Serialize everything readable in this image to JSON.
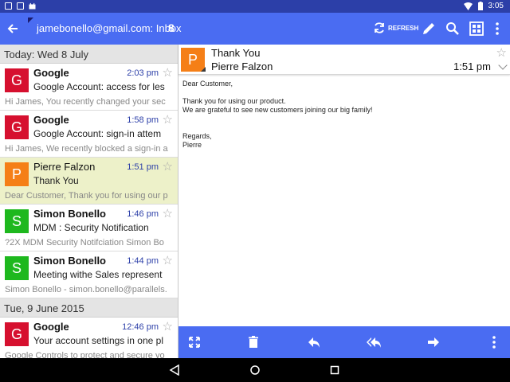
{
  "status_bar": {
    "time": "3:05"
  },
  "app_bar": {
    "account_title": "jamebonello@gmail.com: Inbox",
    "unread_count": "8",
    "refresh_label": "REFRESH"
  },
  "groups": [
    {
      "date": "Today: Wed 8 July"
    },
    {
      "date": "Tue, 9 June 2015"
    }
  ],
  "messages": [
    {
      "initial": "G",
      "color": "#d6102f",
      "sender": "Google",
      "time": "2:03 pm",
      "subject": "Google Account: access for les",
      "preview": "Hi James, You recently changed your sec",
      "bold": true
    },
    {
      "initial": "G",
      "color": "#d6102f",
      "sender": "Google",
      "time": "1:58 pm",
      "subject": "Google Account: sign-in attem",
      "preview": "Hi James, We recently blocked a sign-in a",
      "bold": true
    },
    {
      "initial": "P",
      "color": "#f57f17",
      "sender": "Pierre Falzon",
      "time": "1:51 pm",
      "subject": "Thank You",
      "preview": "Dear Customer, Thank you for using our p",
      "bold": false,
      "selected": true
    },
    {
      "initial": "S",
      "color": "#1eb81e",
      "sender": "Simon Bonello",
      "time": "1:46 pm",
      "subject": "MDM : Security Notification",
      "preview": "?2X MDM Security Notifciation Simon Bo",
      "bold": true
    },
    {
      "initial": "S",
      "color": "#1eb81e",
      "sender": "Simon Bonello",
      "time": "1:44 pm",
      "subject": "Meeting withe Sales represent",
      "preview": "Simon Bonello - simon.bonello@parallels.",
      "bold": true
    },
    {
      "initial": "G",
      "color": "#d6102f",
      "sender": "Google",
      "time": "12:46 pm",
      "subject": "Your account settings in one pl",
      "preview": "Google Controls to protect and secure yo",
      "bold": true
    }
  ],
  "detail": {
    "initial": "P",
    "color": "#f57f17",
    "subject": "Thank You",
    "sender": "Pierre Falzon",
    "time": "1:51 pm",
    "body": {
      "greeting": "Dear Customer,",
      "line1": "Thank you for using our product.",
      "line2": "We are grateful to see new customers joining our big family!",
      "closing": "Regards,",
      "signature": "Pierre"
    }
  },
  "icons": {
    "back": "arrow-back-icon",
    "refresh": "refresh-icon",
    "compose": "pencil-icon",
    "search": "search-icon",
    "grid": "grid-icon",
    "overflow": "more-vert-icon",
    "fullscreen": "fullscreen-icon",
    "delete": "trash-icon",
    "reply": "reply-icon",
    "reply_all": "reply-all-icon",
    "forward": "forward-icon",
    "more": "more-vert-icon"
  }
}
